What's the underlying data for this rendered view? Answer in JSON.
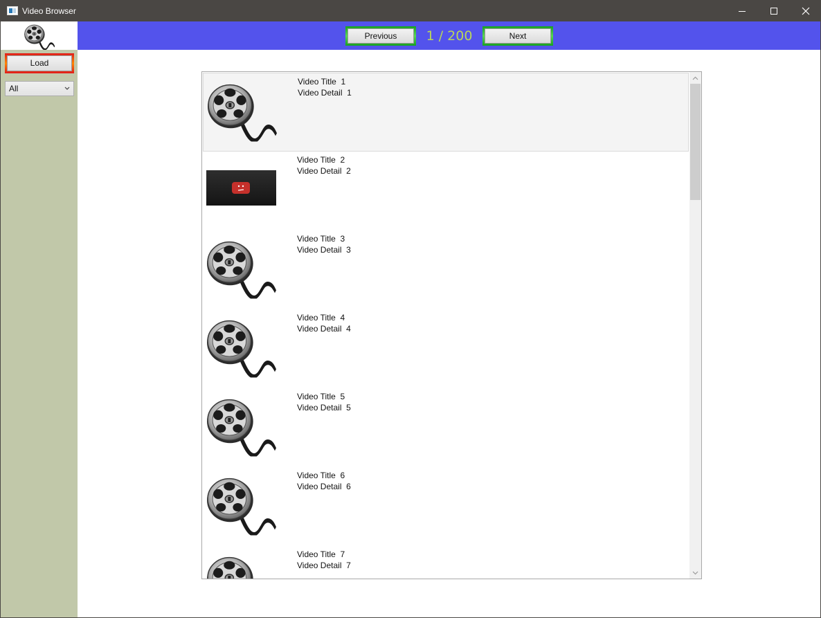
{
  "window": {
    "title": "Video Browser",
    "app_icon": "app-window-icon",
    "controls": [
      "minimize-icon",
      "maximize-icon",
      "close-icon"
    ]
  },
  "sidebar": {
    "logo": "film-reel-icon",
    "load_label": "Load",
    "filter": {
      "selected": "All"
    }
  },
  "nav": {
    "previous_label": "Previous",
    "next_label": "Next",
    "page_indicator": "1 / 200"
  },
  "list": {
    "items": [
      {
        "title": "Video Title  1",
        "detail": "Video Detail  1",
        "thumbnail": "film-reel-icon",
        "selected": true
      },
      {
        "title": "Video Title  2",
        "detail": "Video Detail  2",
        "thumbnail": "video-unavailable-thumbnail",
        "selected": false
      },
      {
        "title": "Video Title  3",
        "detail": "Video Detail  3",
        "thumbnail": "film-reel-icon",
        "selected": false
      },
      {
        "title": "Video Title  4",
        "detail": "Video Detail  4",
        "thumbnail": "film-reel-icon",
        "selected": false
      },
      {
        "title": "Video Title  5",
        "detail": "Video Detail  5",
        "thumbnail": "film-reel-icon",
        "selected": false
      },
      {
        "title": "Video Title  6",
        "detail": "Video Detail  6",
        "thumbnail": "film-reel-icon",
        "selected": false
      },
      {
        "title": "Video Title  7",
        "detail": "Video Detail  7",
        "thumbnail": "film-reel-icon",
        "selected": false
      }
    ]
  },
  "colors": {
    "titlebar": "#4a4744",
    "sidebar": "#c1c8a9",
    "navbar": "#5353ec",
    "page_indicator": "#b9d65a",
    "load_border": "#ff6a00",
    "nav_border": "#2fbf32"
  }
}
